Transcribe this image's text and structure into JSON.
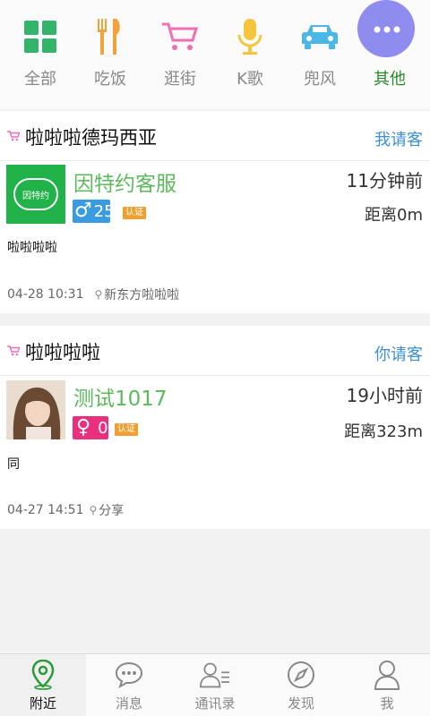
{
  "categories": [
    {
      "label": "全部",
      "icon": "grid-icon",
      "color": "#34b36b"
    },
    {
      "label": "吃饭",
      "icon": "fork-knife-icon",
      "color": "#f2a23a"
    },
    {
      "label": "逛街",
      "icon": "shopping-cart-icon",
      "color": "#ef6fb0"
    },
    {
      "label": "K歌",
      "icon": "microphone-icon",
      "color": "#f4c53d"
    },
    {
      "label": "兜风",
      "icon": "car-icon",
      "color": "#4ab7e6"
    },
    {
      "label": "其他",
      "icon": "more-icon",
      "color": "#8e8cee",
      "active": true
    }
  ],
  "posts": [
    {
      "title": "啦啦啦德玛西亚",
      "treat": "我请客",
      "avatar_text": "因特约",
      "username": "因特约客服",
      "time_ago": "11分钟前",
      "distance": "距离0m",
      "gender": "male",
      "gender_symbol": "♂",
      "age": "25",
      "verified": "认证",
      "message": "啦啦啦啦",
      "date": "04-28 10:31",
      "location": "新东方啦啦啦"
    },
    {
      "title": "啦啦啦啦",
      "treat": "你请客",
      "username": "测试1017",
      "time_ago": "19小时前",
      "distance": "距离323m",
      "gender": "female",
      "gender_symbol": "♀",
      "age": "0",
      "verified": "认证",
      "message": "同",
      "date": "04-27 14:51",
      "location": "分享"
    }
  ],
  "tabs": [
    {
      "label": "附近",
      "icon": "location-pin-icon",
      "active": true
    },
    {
      "label": "消息",
      "icon": "chat-bubble-icon"
    },
    {
      "label": "通讯录",
      "icon": "contacts-icon"
    },
    {
      "label": "发现",
      "icon": "compass-icon"
    },
    {
      "label": "我",
      "icon": "person-icon"
    }
  ],
  "colors": {
    "accent_green": "#5cba5c",
    "link_blue": "#3f8fd6",
    "male_blue": "#3a9ce0",
    "female_pink": "#e8307f",
    "verify_orange": "#f0a030"
  }
}
